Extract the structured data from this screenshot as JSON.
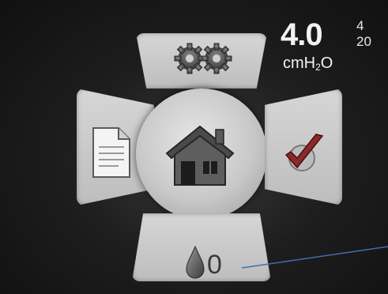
{
  "pressure": {
    "value": "4.0",
    "unit_base": "cmH",
    "unit_sub": "2",
    "unit_tail": "O"
  },
  "ramp_range": {
    "max": "4",
    "min": "20"
  },
  "humidifier": {
    "level": "0"
  },
  "menu": {
    "top": {
      "icon": "gears-icon"
    },
    "left": {
      "icon": "document-icon"
    },
    "center": {
      "icon": "home-icon"
    },
    "right": {
      "icon": "checkmark-icon"
    },
    "bottom": {
      "icon": "water-drop-icon"
    }
  },
  "colors": {
    "panel": "#c8c8c8",
    "annotation_line": "#3f6fb0"
  }
}
